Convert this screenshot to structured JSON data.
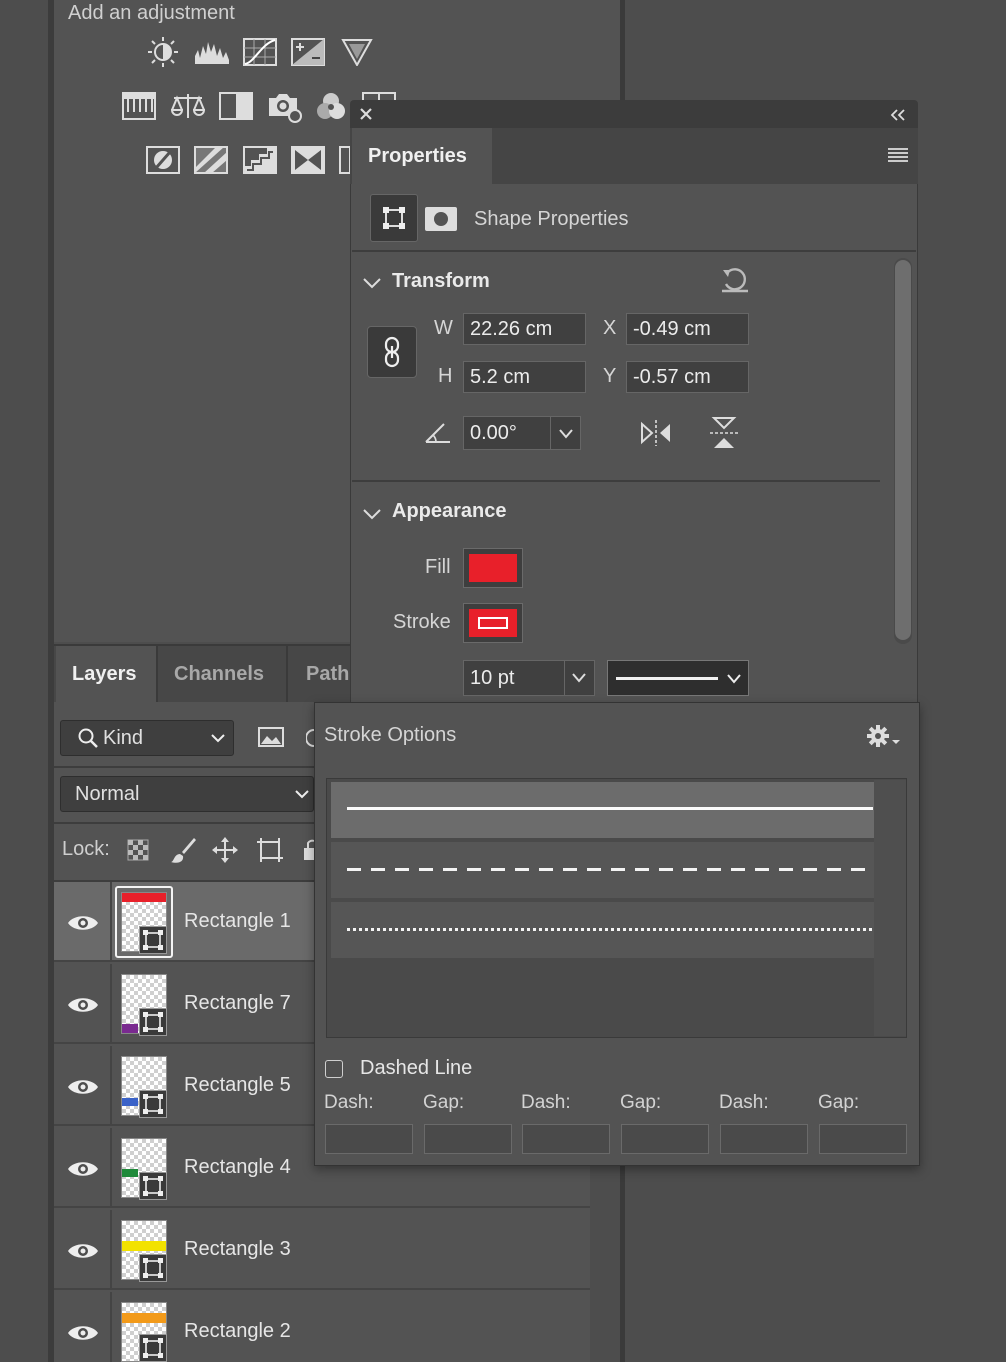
{
  "adjustments": {
    "title": "Add an adjustment",
    "icons": [
      "brightness-contrast-icon",
      "levels-icon",
      "curves-icon",
      "exposure-icon",
      "vibrance-icon",
      "hue-saturation-icon",
      "color-balance-icon",
      "black-white-icon",
      "photo-filter-icon",
      "channel-mixer-icon",
      "color-lookup-icon",
      "invert-icon",
      "posterize-icon",
      "threshold-icon",
      "gradient-map-icon",
      "selective-color-icon"
    ]
  },
  "layers_panel": {
    "tabs": [
      {
        "label": "Layers",
        "active": true
      },
      {
        "label": "Channels",
        "active": false
      },
      {
        "label": "Path",
        "active": false
      }
    ],
    "filter_kind": "Kind",
    "blend_mode": "Normal",
    "lock_label": "Lock:",
    "layers": [
      {
        "name": "Rectangle 1",
        "color": "#e8202a",
        "selected": true
      },
      {
        "name": "Rectangle 7",
        "color": "#7a2a90",
        "selected": false
      },
      {
        "name": "Rectangle 5",
        "color": "#3a62c8",
        "selected": false
      },
      {
        "name": "Rectangle 4",
        "color": "#1f8a3a",
        "selected": false
      },
      {
        "name": "Rectangle 3",
        "color": "#f2e200",
        "selected": false
      },
      {
        "name": "Rectangle 2",
        "color": "#f29a1a",
        "selected": false
      }
    ]
  },
  "properties": {
    "tab_label": "Properties",
    "subtitle": "Shape Properties",
    "transform": {
      "header": "Transform",
      "w_label": "W",
      "w_value": "22.26 cm",
      "h_label": "H",
      "h_value": "5.2 cm",
      "x_label": "X",
      "x_value": "-0.49 cm",
      "y_label": "Y",
      "y_value": "-0.57 cm",
      "angle_value": "0.00°"
    },
    "appearance": {
      "header": "Appearance",
      "fill_label": "Fill",
      "fill_color": "#e8202a",
      "stroke_label": "Stroke",
      "stroke_color": "#e8202a",
      "stroke_width": "10 pt"
    }
  },
  "stroke_options": {
    "title": "Stroke Options",
    "styles": [
      "solid",
      "dashed",
      "dotted"
    ],
    "selected_style": "solid",
    "dashed_line_label": "Dashed Line",
    "dashed_line_checked": false,
    "dash_label": "Dash:",
    "gap_label": "Gap:"
  }
}
